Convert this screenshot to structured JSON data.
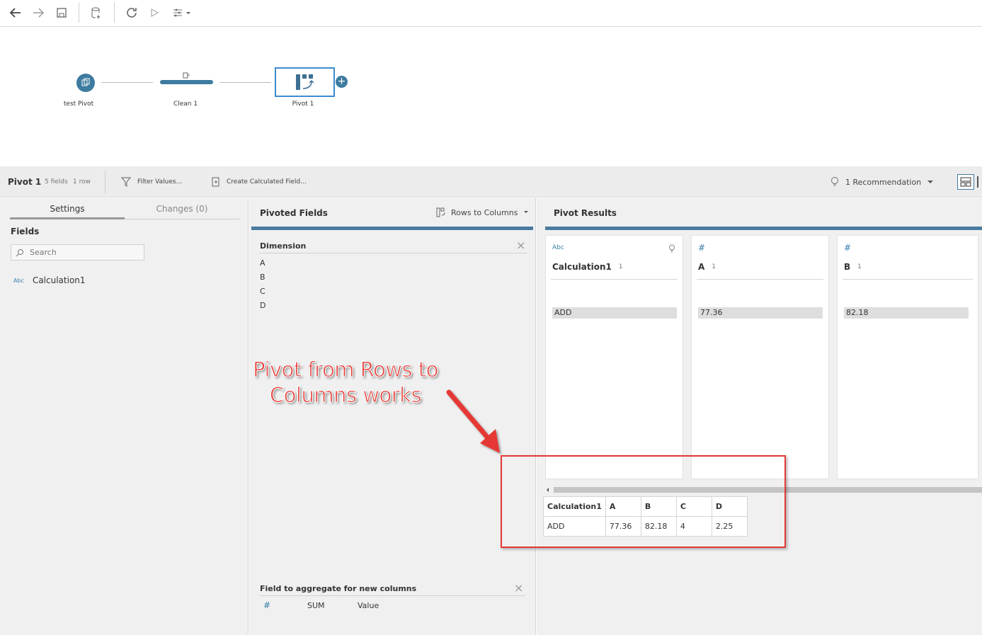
{
  "flow": {
    "nodes": [
      {
        "label": "test Pivot"
      },
      {
        "label": "Clean 1"
      },
      {
        "label": "Pivot 1"
      }
    ]
  },
  "stepbar": {
    "title": "Pivot 1",
    "fields": "5 fields",
    "rows": "1 row",
    "filter": "Filter Values...",
    "calc": "Create Calculated Field...",
    "recommendation": "1 Recommendation"
  },
  "settings": {
    "tabs": [
      {
        "label": "Settings"
      },
      {
        "label": "Changes (0)"
      }
    ],
    "fields_title": "Fields",
    "search_placeholder": "Search",
    "field": {
      "type": "Abc",
      "name": "Calculation1"
    }
  },
  "pivoted": {
    "title": "Pivoted Fields",
    "mode": "Rows to Columns",
    "dimension_title": "Dimension",
    "dimension_items": [
      "A",
      "B",
      "C",
      "D"
    ],
    "aggregate_title": "Field to aggregate for new columns",
    "aggregate": {
      "func": "SUM",
      "field": "Value"
    }
  },
  "results": {
    "title": "Pivot Results",
    "cards": [
      {
        "type": "Abc",
        "name": "Calculation1",
        "count": "1",
        "value": "ADD"
      },
      {
        "type": "#",
        "name": "A",
        "count": "1",
        "value": "77.36"
      },
      {
        "type": "#",
        "name": "B",
        "count": "1",
        "value": "82.18"
      }
    ],
    "preview": {
      "headers": [
        "Calculation1",
        "A",
        "B",
        "C",
        "D"
      ],
      "row": [
        "ADD",
        "77.36",
        "82.18",
        "4",
        "2.25"
      ]
    }
  },
  "annotation": {
    "line1": "Pivot from Rows to",
    "line2": "Columns works"
  },
  "colors": {
    "accent": "#4a7ba1",
    "annotation": "#e53935",
    "node": "#3d7ba0"
  }
}
